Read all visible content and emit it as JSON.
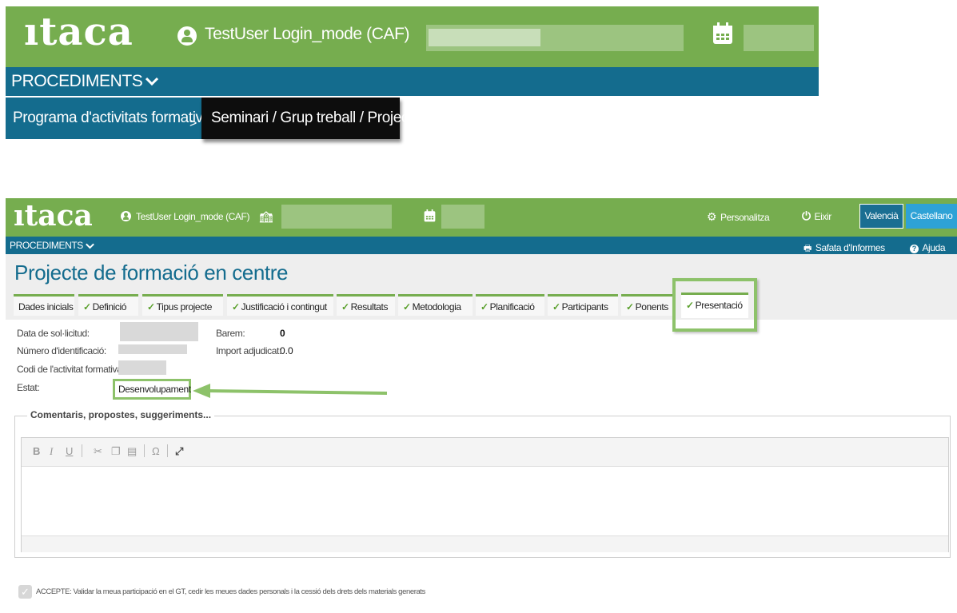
{
  "top": {
    "logo": "ıtaca",
    "user": "TestUser Login_mode (CAF)",
    "nav_menu": "PROCEDIMENTS",
    "breadcrumb": [
      "Programa d'activitats formatives",
      "Seminari / Grup treball / Projecte"
    ]
  },
  "app": {
    "logo": "ıtaca",
    "user": "TestUser Login_mode (CAF)",
    "personalize": "Personalitza",
    "exit": "Eixir",
    "lang_valencia": "Valencià",
    "lang_castellano": "Castellano",
    "nav_menu": "PROCEDIMENTS",
    "reports": "Safata d'Informes",
    "help": "Ajuda"
  },
  "page": {
    "title": "Projecte de formació en centre",
    "tabs": [
      {
        "label": "Dades inicials",
        "checked": false
      },
      {
        "label": "Definició",
        "checked": true
      },
      {
        "label": "Tipus projecte",
        "checked": true
      },
      {
        "label": "Justificació i contingut",
        "checked": true
      },
      {
        "label": "Resultats",
        "checked": true
      },
      {
        "label": "Metodologia",
        "checked": true
      },
      {
        "label": "Planificació",
        "checked": true
      },
      {
        "label": "Participants",
        "checked": true
      },
      {
        "label": "Ponents",
        "checked": true
      },
      {
        "label": "Presentació",
        "checked": true,
        "active": true
      }
    ]
  },
  "details": {
    "data_sollicitud_label": "Data de sol·licitud:",
    "numero_label": "Número d'identificació:",
    "codi_label": "Codi de l'activitat formativa:",
    "estat_label": "Estat:",
    "estat_value": "Desenvolupament",
    "barem_label": "Barem:",
    "barem_value": "0",
    "import_label": "Import adjudicat:",
    "import_value": "0.0"
  },
  "comments": {
    "legend": "Comentaris, propostes, suggeriments...",
    "toolbar": [
      "bold-icon",
      "italic-icon",
      "underline-icon",
      "cut-icon",
      "copy-icon",
      "paste-icon",
      "special-char-icon",
      "maximize-icon"
    ]
  },
  "accept": {
    "text": "ACCEPTE: Validar la meua participació en el GT, cedir les meues dades personals i la cessió dels drets dels materials generats"
  },
  "colors": {
    "green": "#76ad4f",
    "blue": "#146c8e",
    "highlight": "#8dc26a"
  }
}
